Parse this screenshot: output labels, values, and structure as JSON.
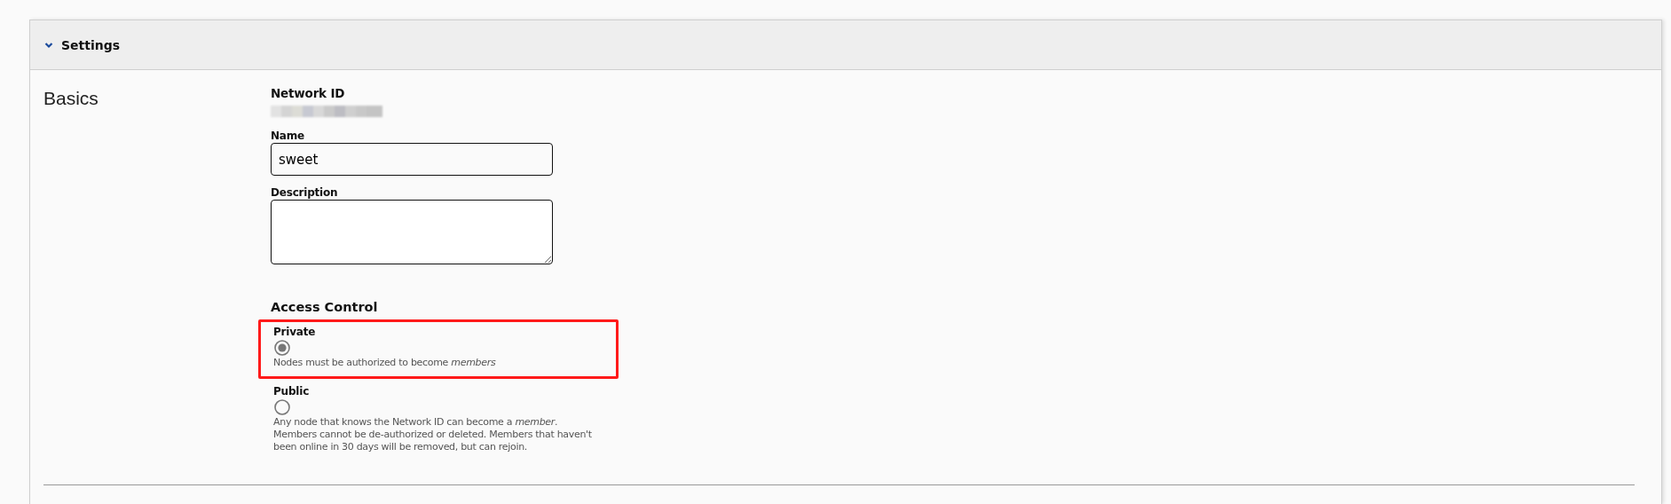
{
  "panel": {
    "title": "Settings",
    "expanded": true
  },
  "section": {
    "title": "Basics"
  },
  "network_id": {
    "label": "Network ID"
  },
  "fields": [
    {
      "label": "Name",
      "kind": "input",
      "value": "sweet"
    },
    {
      "label": "Description",
      "kind": "textarea"
    }
  ],
  "access_control": {
    "title": "Access Control",
    "options": [
      {
        "label": "Private",
        "selected": true,
        "highlighted": true,
        "help": "Nodes must be authorized to become *members*"
      },
      {
        "label": "Public",
        "selected": false,
        "highlighted": false,
        "help": "Any node that knows the Network ID can become a *member*. Members cannot be de-authorized or deleted. Members that haven't been online in 30 days will be removed, but can rejoin."
      }
    ]
  }
}
